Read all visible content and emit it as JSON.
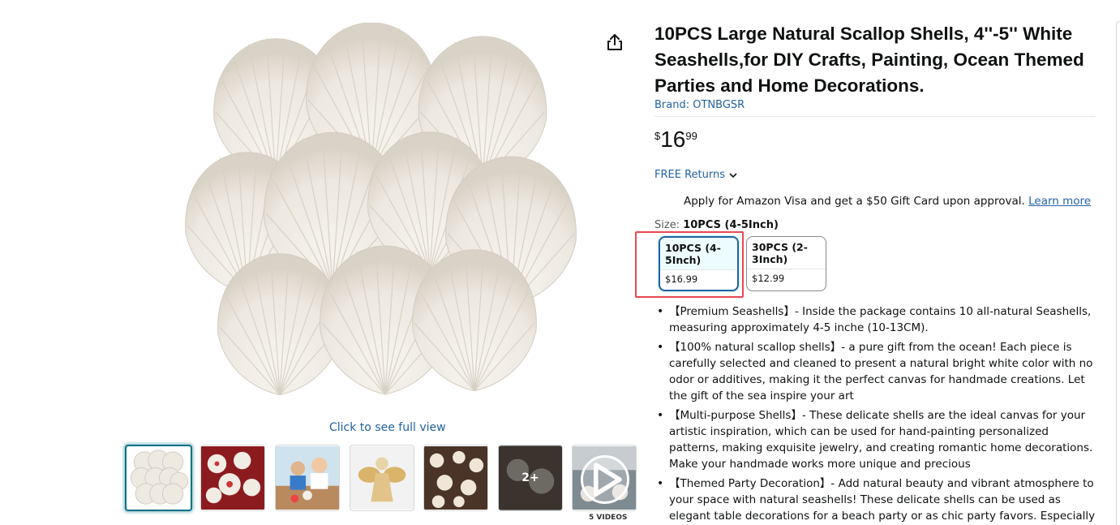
{
  "product": {
    "title": "10PCS Large Natural Scallop Shells, 4''-5'' White Seashells,for DIY Crafts, Painting, Ocean Themed Parties and Home Decorations.",
    "brand": "Brand: OTNBGSR",
    "price": {
      "symbol": "$",
      "whole": "16",
      "fraction": "99"
    },
    "returns": "FREE Returns",
    "visa_offer": "Apply for Amazon Visa and get a $50 Gift Card upon approval.",
    "visa_link": "Learn more",
    "size_label": "Size:",
    "size_selected": "10PCS (4-5Inch)",
    "sizes": [
      {
        "name": "10PCS (4-5Inch)",
        "price": "$16.99"
      },
      {
        "name": "30PCS (2-3Inch)",
        "price": "$12.99"
      }
    ],
    "bullets": [
      "【Premium Seashells】- Inside the package contains 10 all-natural Seashells, measuring approximately 4-5 inche (10-13CM).",
      "【100% natural scallop shells】- a pure gift from the ocean! Each piece is carefully selected and cleaned to present a natural bright white color with no odor or additives, making it the perfect canvas for handmade creations. Let the gift of the sea inspire your art",
      "【Multi-purpose Shells】- These delicate shells are the ideal canvas for your artistic inspiration, which can be used for hand-painting personalized patterns, making exquisite jewelry, and creating romantic home decorations. Make your handmade works more unique and precious",
      "【Themed Party Decoration】- Add natural beauty and vibrant atmosphere to your space with natural seashells! These delicate shells can be used as elegant table decorations for a beach party or as chic party favors. Especially suitable for"
    ]
  },
  "gallery": {
    "full_view": "Click to see full view",
    "more_count": "2+",
    "videos_label": "5 VIDEOS"
  },
  "colors": {
    "link": "#2162a1",
    "selected_border": "#2162a1",
    "highlight": "#e8484f"
  }
}
